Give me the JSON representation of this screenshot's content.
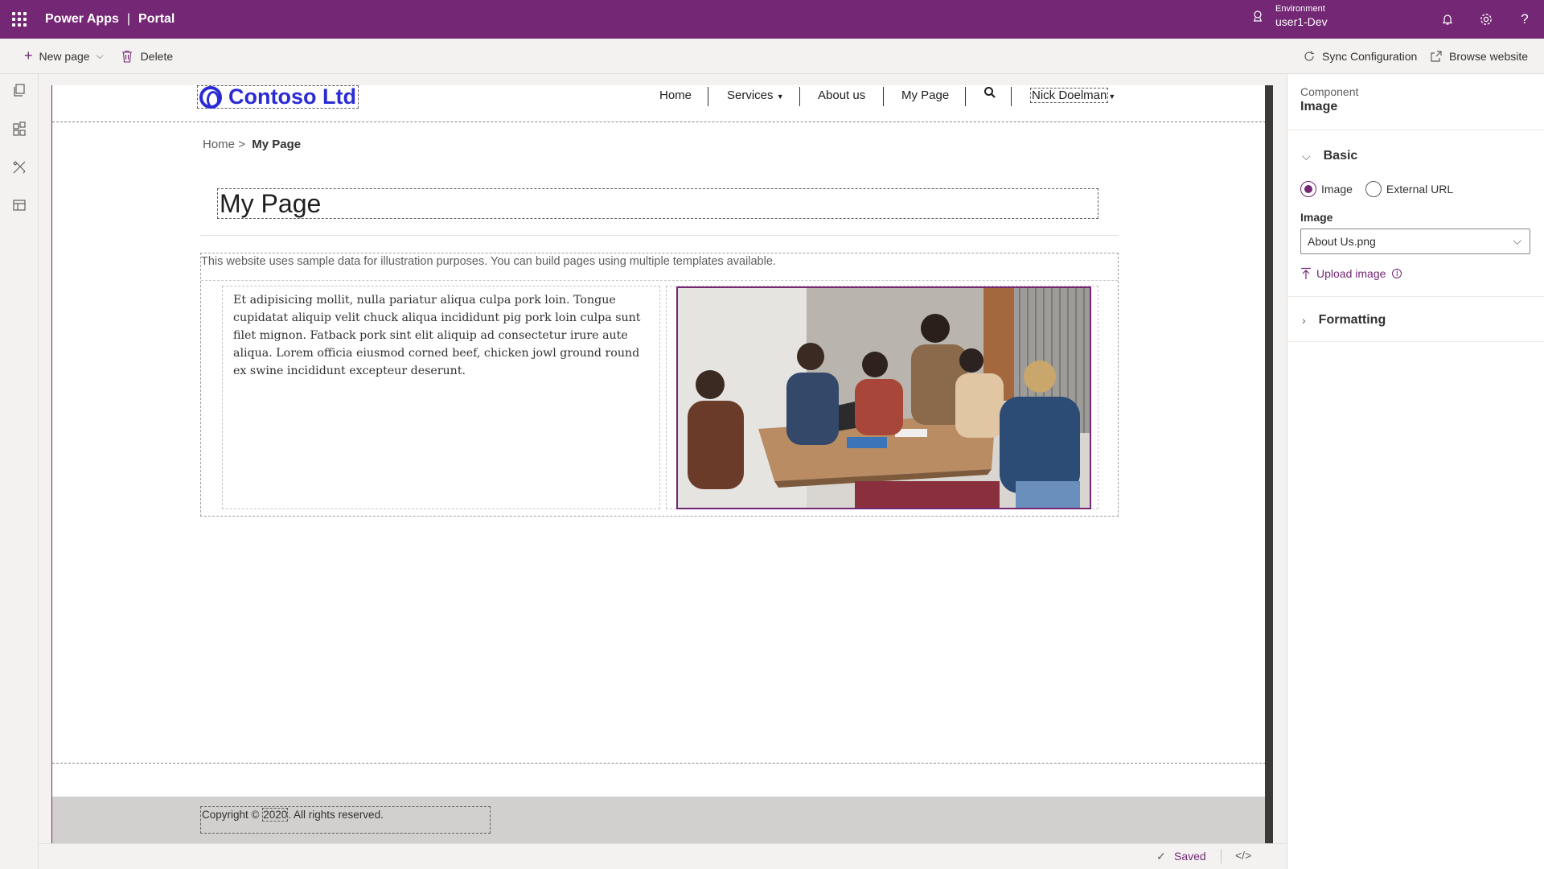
{
  "topbar": {
    "app_name": "Power Apps",
    "separator": "|",
    "sub_name": "Portal",
    "environment_label": "Environment",
    "environment_value": "user1-Dev",
    "color": "#742774"
  },
  "commandbar": {
    "new_page": "New page",
    "delete": "Delete",
    "sync": "Sync Configuration",
    "browse": "Browse website"
  },
  "rail": {
    "items": [
      "pages-icon",
      "components-icon",
      "themes-icon",
      "templates-icon"
    ]
  },
  "site": {
    "logo": "Contoso Ltd",
    "nav": [
      "Home",
      "Services",
      "About us",
      "My Page"
    ],
    "user": "Nick Doelman",
    "breadcrumb_home": "Home",
    "breadcrumb_sep": ">",
    "breadcrumb_current": "My Page",
    "page_title": "My Page",
    "intro": "This website uses sample data for illustration purposes. You can build pages using multiple templates available.",
    "body_text": "Et adipisicing mollit, nulla pariatur aliqua culpa pork loin. Tongue cupidatat aliquip velit chuck aliqua incididunt pig pork loin culpa sunt filet mignon. Fatback pork sint elit aliquip ad consectetur irure aute aliqua. Lorem officia eiusmod corned beef, chicken jowl ground round ex swine incididunt excepteur deserunt.",
    "copyright_prefix": "Copyright © ",
    "copyright_year": "2020",
    "copyright_suffix": ". All rights reserved."
  },
  "pane": {
    "component_label": "Component",
    "component_name": "Image",
    "basic_label": "Basic",
    "radio_image": "Image",
    "radio_external": "External URL",
    "selected_source": "Image",
    "image_label": "Image",
    "image_value": "About Us.png",
    "upload_label": "Upload image",
    "formatting_label": "Formatting"
  },
  "status": {
    "saved": "Saved",
    "code_icon": "code-view-icon"
  }
}
